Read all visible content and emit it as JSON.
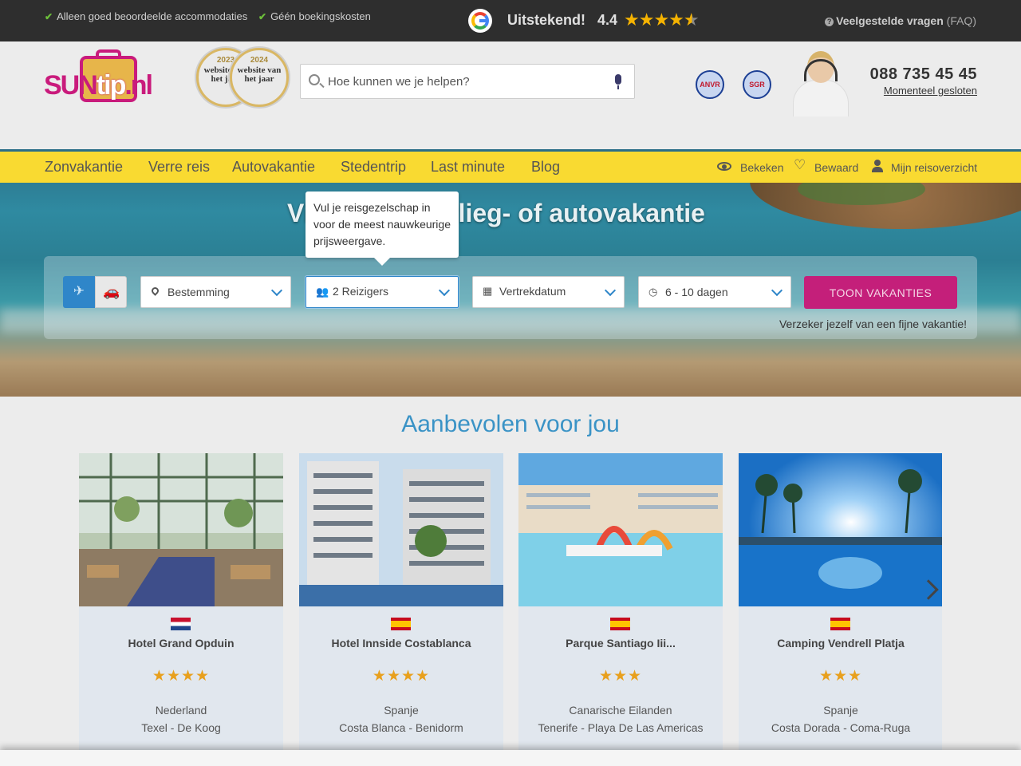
{
  "topbar": {
    "usps": [
      "Alleen goed beoordeelde accommodaties",
      "Géén boekingskosten"
    ],
    "rating_word": "Uitstekend!",
    "rating_score": "4.4",
    "faq_label": "Veelgestelde vragen",
    "faq_suffix": "(FAQ)"
  },
  "header": {
    "logo": {
      "sun": "SUN",
      "tip": "tip",
      "nl": ".nl"
    },
    "awards": [
      {
        "year": "2023",
        "label": "website van het jaar"
      },
      {
        "year": "2024",
        "label": "website van het jaar"
      }
    ],
    "search_placeholder": "Hoe kunnen we je helpen?",
    "memberships": [
      "ANVR",
      "SGR"
    ],
    "phone": "088 735 45 45",
    "phone_status": "Momenteel gesloten"
  },
  "nav": {
    "items": [
      "Zonvakantie",
      "Verre reis",
      "Autovakantie",
      "Stedentrip",
      "Last minute",
      "Blog"
    ],
    "right": [
      "Bekeken",
      "Bewaard",
      "Mijn reisoverzicht"
    ]
  },
  "hero": {
    "title": "Vind je zon-, vlieg- of autovakantie"
  },
  "search_panel": {
    "destination": "Bestemming",
    "travelers": "2 Reizigers",
    "departure": "Vertrekdatum",
    "duration": "6 - 10 dagen",
    "submit": "TOON VAKANTIES",
    "insure": "Verzeker jezelf van een fijne vakantie!",
    "tooltip": "Vul je reisgezelschap in voor de meest nauwkeurige prijsweergave."
  },
  "recommended": {
    "title": "Aanbevolen voor jou",
    "cards": [
      {
        "name": "Hotel Grand Opduin",
        "stars": "★★★★",
        "country": "Nederland",
        "region": "Texel - De Koog",
        "flag": "nl"
      },
      {
        "name": "Hotel Innside Costablanca",
        "stars": "★★★★",
        "country": "Spanje",
        "region": "Costa Blanca - Benidorm",
        "flag": "es"
      },
      {
        "name": "Parque Santiago Iii...",
        "stars": "★★★",
        "country": "Canarische Eilanden",
        "region": "Tenerife - Playa De Las Americas",
        "flag": "es"
      },
      {
        "name": "Camping Vendrell Platja",
        "stars": "★★★",
        "country": "Spanje",
        "region": "Costa Dorada - Coma-Ruga",
        "flag": "es"
      }
    ]
  },
  "colors": {
    "nav_yellow": "#f9da31",
    "accent_pink": "#c41f7a",
    "accent_blue": "#2f86c9",
    "title_blue": "#3a93c6"
  }
}
